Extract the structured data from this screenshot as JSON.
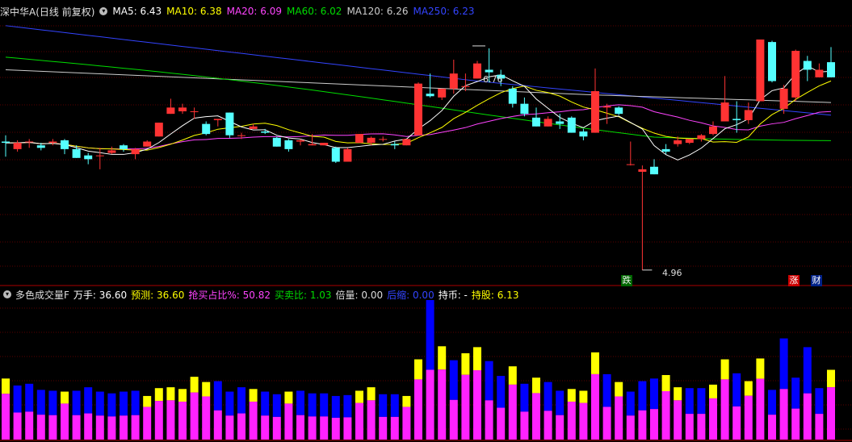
{
  "legend": {
    "title": "深中华A(日线 前复权)",
    "ma5": "MA5: 6.43",
    "ma10": "MA10: 6.38",
    "ma20": "MA20: 6.09",
    "ma60": "MA60: 6.02",
    "ma120": "MA120: 6.26",
    "ma250": "MA250: 6.23",
    "colors": {
      "ma5": "#ffffff",
      "ma10": "#ffff00",
      "ma20": "#ff44ff",
      "ma60": "#00dd00",
      "ma120": "#cccccc",
      "ma250": "#3344ff"
    }
  },
  "annotations": {
    "high": "6.76",
    "low": "4.96",
    "badge_down": "跌",
    "badge_up": "涨",
    "badge_cai": "财"
  },
  "volume_legend": {
    "name": "多色成交量F",
    "wanshou": "万手: 36.60",
    "yuce": "预测: 36.60",
    "qiangmai": "抢买占比%: 50.82",
    "maimai": "买卖比: 1.03",
    "beiliang": "倍量: 0.00",
    "hosuo": "后缩: 0.00",
    "chibi": "持币: -",
    "chigu": "持股: 6.13"
  },
  "chart_data": {
    "type": "candlestick",
    "candles": [
      {
        "o": 5.98,
        "c": 5.97,
        "h": 6.03,
        "l": 5.86,
        "up": true
      },
      {
        "o": 5.92,
        "c": 5.97,
        "h": 5.99,
        "l": 5.9,
        "up": true
      },
      {
        "o": 5.98,
        "c": 5.98,
        "h": 6.0,
        "l": 5.93,
        "up": false
      },
      {
        "o": 5.95,
        "c": 5.93,
        "h": 5.97,
        "l": 5.91,
        "up": false
      },
      {
        "o": 5.97,
        "c": 5.98,
        "h": 6.0,
        "l": 5.95,
        "up": true
      },
      {
        "o": 5.99,
        "c": 5.92,
        "h": 6.0,
        "l": 5.88,
        "up": false
      },
      {
        "o": 5.92,
        "c": 5.85,
        "h": 5.95,
        "l": 5.85,
        "up": false
      },
      {
        "o": 5.87,
        "c": 5.84,
        "h": 5.89,
        "l": 5.8,
        "up": false
      },
      {
        "o": 5.87,
        "c": 5.87,
        "h": 5.93,
        "l": 5.76,
        "up": false
      },
      {
        "o": 5.89,
        "c": 5.91,
        "h": 5.94,
        "l": 5.88,
        "up": true
      },
      {
        "o": 5.95,
        "c": 5.92,
        "h": 5.96,
        "l": 5.9,
        "up": false
      },
      {
        "o": 5.88,
        "c": 5.92,
        "h": 5.93,
        "l": 5.84,
        "up": true
      },
      {
        "o": 5.94,
        "c": 5.98,
        "h": 5.99,
        "l": 5.94,
        "up": true
      },
      {
        "o": 6.02,
        "c": 6.13,
        "h": 6.13,
        "l": 6.02,
        "up": true
      },
      {
        "o": 6.2,
        "c": 6.25,
        "h": 6.32,
        "l": 6.2,
        "up": true
      },
      {
        "o": 6.22,
        "c": 6.25,
        "h": 6.28,
        "l": 6.2,
        "up": true
      },
      {
        "o": 6.22,
        "c": 6.22,
        "h": 6.25,
        "l": 6.16,
        "up": true
      },
      {
        "o": 6.12,
        "c": 6.04,
        "h": 6.14,
        "l": 6.03,
        "up": false
      },
      {
        "o": 6.15,
        "c": 6.16,
        "h": 6.16,
        "l": 6.1,
        "up": true
      },
      {
        "o": 6.21,
        "c": 6.03,
        "h": 6.21,
        "l": 6.01,
        "up": false
      },
      {
        "o": 6.03,
        "c": 6.03,
        "h": 6.05,
        "l": 6.0,
        "up": true
      },
      {
        "o": 6.08,
        "c": 6.1,
        "h": 6.12,
        "l": 6.08,
        "up": true
      },
      {
        "o": 6.06,
        "c": 6.05,
        "h": 6.08,
        "l": 6.04,
        "up": false
      },
      {
        "o": 6.01,
        "c": 5.94,
        "h": 6.02,
        "l": 5.94,
        "up": false
      },
      {
        "o": 5.99,
        "c": 5.92,
        "h": 6.0,
        "l": 5.9,
        "up": false
      },
      {
        "o": 5.98,
        "c": 5.99,
        "h": 6.0,
        "l": 5.95,
        "up": true
      },
      {
        "o": 5.95,
        "c": 5.96,
        "h": 6.04,
        "l": 5.95,
        "up": true
      },
      {
        "o": 5.95,
        "c": 5.97,
        "h": 5.97,
        "l": 5.95,
        "up": true
      },
      {
        "o": 5.93,
        "c": 5.82,
        "h": 5.94,
        "l": 5.81,
        "up": false
      },
      {
        "o": 5.82,
        "c": 5.92,
        "h": 5.93,
        "l": 5.82,
        "up": true
      },
      {
        "o": 5.97,
        "c": 6.04,
        "h": 6.04,
        "l": 5.97,
        "up": true
      },
      {
        "o": 5.97,
        "c": 6.01,
        "h": 6.02,
        "l": 5.95,
        "up": false
      },
      {
        "o": 6.0,
        "c": 6.0,
        "h": 6.02,
        "l": 5.98,
        "up": false
      },
      {
        "o": 5.96,
        "c": 5.95,
        "h": 5.98,
        "l": 5.92,
        "up": false
      },
      {
        "o": 5.95,
        "c": 6.0,
        "h": 6.0,
        "l": 5.95,
        "up": true
      },
      {
        "o": 6.03,
        "c": 6.44,
        "h": 6.45,
        "l": 6.03,
        "up": true
      },
      {
        "o": 6.36,
        "c": 6.34,
        "h": 6.52,
        "l": 6.33,
        "up": false
      },
      {
        "o": 6.33,
        "c": 6.4,
        "h": 6.4,
        "l": 6.31,
        "up": true
      },
      {
        "o": 6.4,
        "c": 6.52,
        "h": 6.63,
        "l": 6.36,
        "up": false
      },
      {
        "o": 6.42,
        "c": 6.42,
        "h": 6.52,
        "l": 6.38,
        "up": false
      },
      {
        "o": 6.48,
        "c": 6.6,
        "h": 6.62,
        "l": 6.48,
        "up": true
      },
      {
        "o": 6.55,
        "c": 6.53,
        "h": 6.72,
        "l": 6.45,
        "up": false
      },
      {
        "o": 6.51,
        "c": 6.48,
        "h": 6.55,
        "l": 6.42,
        "up": false
      },
      {
        "o": 6.4,
        "c": 6.28,
        "h": 6.42,
        "l": 6.25,
        "up": false
      },
      {
        "o": 6.28,
        "c": 6.2,
        "h": 6.33,
        "l": 6.18,
        "up": false
      },
      {
        "o": 6.17,
        "c": 6.1,
        "h": 6.25,
        "l": 6.1,
        "up": false
      },
      {
        "o": 6.1,
        "c": 6.16,
        "h": 6.18,
        "l": 6.1,
        "up": true
      },
      {
        "o": 6.14,
        "c": 6.12,
        "h": 6.2,
        "l": 6.08,
        "up": true
      },
      {
        "o": 6.17,
        "c": 6.05,
        "h": 6.18,
        "l": 6.05,
        "up": false
      },
      {
        "o": 6.06,
        "c": 6.02,
        "h": 6.08,
        "l": 5.99,
        "up": true
      },
      {
        "o": 6.05,
        "c": 6.38,
        "h": 6.56,
        "l": 6.05,
        "up": true
      },
      {
        "o": 6.25,
        "c": 6.26,
        "h": 6.28,
        "l": 6.12,
        "up": false
      },
      {
        "o": 6.25,
        "c": 6.2,
        "h": 6.26,
        "l": 6.19,
        "up": false
      },
      {
        "o": 5.8,
        "c": 5.8,
        "h": 5.98,
        "l": 5.79,
        "up": false
      },
      {
        "o": 5.74,
        "c": 5.76,
        "h": 5.79,
        "l": 4.96,
        "up": true
      },
      {
        "o": 5.78,
        "c": 5.72,
        "h": 5.84,
        "l": 5.72,
        "up": true
      },
      {
        "o": 5.92,
        "c": 5.9,
        "h": 5.96,
        "l": 5.88,
        "up": false
      },
      {
        "o": 5.96,
        "c": 5.99,
        "h": 6.02,
        "l": 5.94,
        "up": false
      },
      {
        "o": 5.97,
        "c": 6.0,
        "h": 6.0,
        "l": 5.96,
        "up": true
      },
      {
        "o": 6.0,
        "c": 6.03,
        "h": 6.04,
        "l": 5.98,
        "up": true
      },
      {
        "o": 6.04,
        "c": 6.1,
        "h": 6.14,
        "l": 6.03,
        "up": true
      },
      {
        "o": 6.14,
        "c": 6.29,
        "h": 6.5,
        "l": 6.14,
        "up": true
      },
      {
        "o": 6.16,
        "c": 6.15,
        "h": 6.3,
        "l": 6.05,
        "up": false
      },
      {
        "o": 6.15,
        "c": 6.23,
        "h": 6.29,
        "l": 6.12,
        "up": true
      },
      {
        "o": 6.3,
        "c": 6.79,
        "h": 6.79,
        "l": 6.3,
        "up": true
      },
      {
        "o": 6.77,
        "c": 6.46,
        "h": 6.78,
        "l": 6.45,
        "up": false
      },
      {
        "o": 6.24,
        "c": 6.4,
        "h": 6.43,
        "l": 6.2,
        "up": false
      },
      {
        "o": 6.33,
        "c": 6.7,
        "h": 6.71,
        "l": 6.3,
        "up": true
      },
      {
        "o": 6.62,
        "c": 6.55,
        "h": 6.66,
        "l": 6.46,
        "up": false
      },
      {
        "o": 6.49,
        "c": 6.55,
        "h": 6.6,
        "l": 6.49,
        "up": false
      },
      {
        "o": 6.61,
        "c": 6.49,
        "h": 6.73,
        "l": 6.49,
        "up": true
      }
    ],
    "volume": [
      {
        "v": 0.7,
        "c": "yellow"
      },
      {
        "v": 0.62,
        "c": "blue"
      },
      {
        "v": 0.64,
        "c": "blue"
      },
      {
        "v": 0.57,
        "c": "blue"
      },
      {
        "v": 0.56,
        "c": "blue"
      },
      {
        "v": 0.55,
        "c": "yellow"
      },
      {
        "v": 0.56,
        "c": "blue"
      },
      {
        "v": 0.6,
        "c": "blue"
      },
      {
        "v": 0.55,
        "c": "blue"
      },
      {
        "v": 0.53,
        "c": "blue"
      },
      {
        "v": 0.55,
        "c": "blue"
      },
      {
        "v": 0.56,
        "c": "blue"
      },
      {
        "v": 0.5,
        "c": "yellow"
      },
      {
        "v": 0.59,
        "c": "yellow"
      },
      {
        "v": 0.6,
        "c": "yellow"
      },
      {
        "v": 0.58,
        "c": "yellow"
      },
      {
        "v": 0.72,
        "c": "yellow"
      },
      {
        "v": 0.66,
        "c": "yellow"
      },
      {
        "v": 0.67,
        "c": "blue"
      },
      {
        "v": 0.55,
        "c": "blue"
      },
      {
        "v": 0.6,
        "c": "blue"
      },
      {
        "v": 0.58,
        "c": "yellow"
      },
      {
        "v": 0.55,
        "c": "blue"
      },
      {
        "v": 0.52,
        "c": "blue"
      },
      {
        "v": 0.55,
        "c": "yellow"
      },
      {
        "v": 0.56,
        "c": "blue"
      },
      {
        "v": 0.53,
        "c": "blue"
      },
      {
        "v": 0.53,
        "c": "blue"
      },
      {
        "v": 0.5,
        "c": "blue"
      },
      {
        "v": 0.51,
        "c": "blue"
      },
      {
        "v": 0.56,
        "c": "yellow"
      },
      {
        "v": 0.6,
        "c": "yellow"
      },
      {
        "v": 0.52,
        "c": "blue"
      },
      {
        "v": 0.52,
        "c": "blue"
      },
      {
        "v": 0.5,
        "c": "yellow"
      },
      {
        "v": 0.92,
        "c": "yellow"
      },
      {
        "v": 1.6,
        "c": "blue"
      },
      {
        "v": 1.07,
        "c": "yellow"
      },
      {
        "v": 0.91,
        "c": "blue"
      },
      {
        "v": 0.99,
        "c": "yellow"
      },
      {
        "v": 1.06,
        "c": "yellow"
      },
      {
        "v": 0.9,
        "c": "blue"
      },
      {
        "v": 0.73,
        "c": "blue"
      },
      {
        "v": 0.84,
        "c": "yellow"
      },
      {
        "v": 0.64,
        "c": "blue"
      },
      {
        "v": 0.71,
        "c": "yellow"
      },
      {
        "v": 0.66,
        "c": "blue"
      },
      {
        "v": 0.56,
        "c": "blue"
      },
      {
        "v": 0.58,
        "c": "yellow"
      },
      {
        "v": 0.56,
        "c": "yellow"
      },
      {
        "v": 1.0,
        "c": "yellow"
      },
      {
        "v": 0.75,
        "c": "blue"
      },
      {
        "v": 0.66,
        "c": "yellow"
      },
      {
        "v": 0.55,
        "c": "blue"
      },
      {
        "v": 0.67,
        "c": "blue"
      },
      {
        "v": 0.7,
        "c": "blue"
      },
      {
        "v": 0.74,
        "c": "yellow"
      },
      {
        "v": 0.6,
        "c": "yellow"
      },
      {
        "v": 0.59,
        "c": "blue"
      },
      {
        "v": 0.59,
        "c": "blue"
      },
      {
        "v": 0.63,
        "c": "yellow"
      },
      {
        "v": 0.92,
        "c": "yellow"
      },
      {
        "v": 0.76,
        "c": "blue"
      },
      {
        "v": 0.67,
        "c": "yellow"
      },
      {
        "v": 0.93,
        "c": "yellow"
      },
      {
        "v": 0.57,
        "c": "blue"
      },
      {
        "v": 1.16,
        "c": "blue"
      },
      {
        "v": 0.71,
        "c": "blue"
      },
      {
        "v": 1.06,
        "c": "blue"
      },
      {
        "v": 0.59,
        "c": "blue"
      },
      {
        "v": 0.8,
        "c": "yellow"
      }
    ]
  }
}
